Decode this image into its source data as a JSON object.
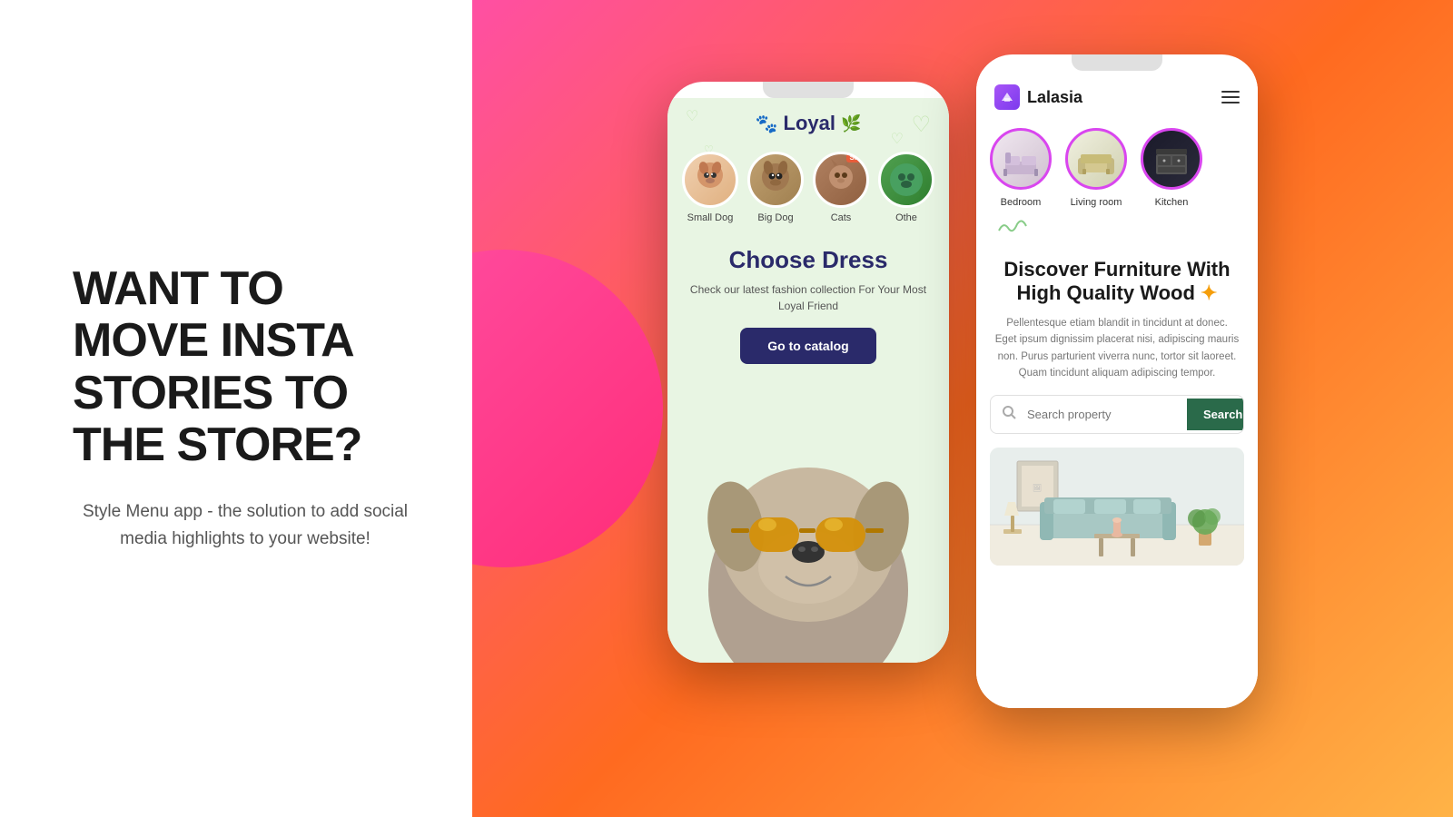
{
  "left": {
    "main_heading": "WANT TO MOVE INSTA STORIES TO THE STORE?",
    "sub_heading": "Style Menu app - the solution to add social media highlights to your website!"
  },
  "phone1": {
    "app_name": "Loyal",
    "paw_icon": "🐾",
    "categories": [
      {
        "label": "Small Dog",
        "has_sale": false
      },
      {
        "label": "Big Dog",
        "has_sale": false
      },
      {
        "label": "Cats",
        "has_sale": true
      },
      {
        "label": "Othe",
        "has_sale": false
      }
    ],
    "sale_badge": "Sale",
    "section_title": "Choose Dress",
    "section_subtitle": "Check our latest fashion collection For Your Most Loyal Friend",
    "cta_button": "Go to catalog"
  },
  "phone2": {
    "app_name": "Lalasia",
    "categories": [
      {
        "label": "Bedroom"
      },
      {
        "label": "Living room"
      },
      {
        "label": "Kitchen"
      }
    ],
    "heading_line1": "Discover Furniture With",
    "heading_line2": "High Quality Wood",
    "description": "Pellentesque etiam blandit in tincidunt at donec. Eget ipsum dignissim placerat nisi, adipiscing mauris non. Purus parturient viverra nunc, tortor sit laoreet. Quam tincidunt aliquam adipiscing tempor.",
    "search_placeholder": "Search property",
    "search_button": "Search"
  },
  "colors": {
    "gradient_start": "#ff4fa3",
    "gradient_mid": "#ff6a20",
    "gradient_end": "#ffb347",
    "dark_navy": "#2a2a6a",
    "dark_green": "#2a6a4a",
    "purple_border": "#d946ef"
  }
}
